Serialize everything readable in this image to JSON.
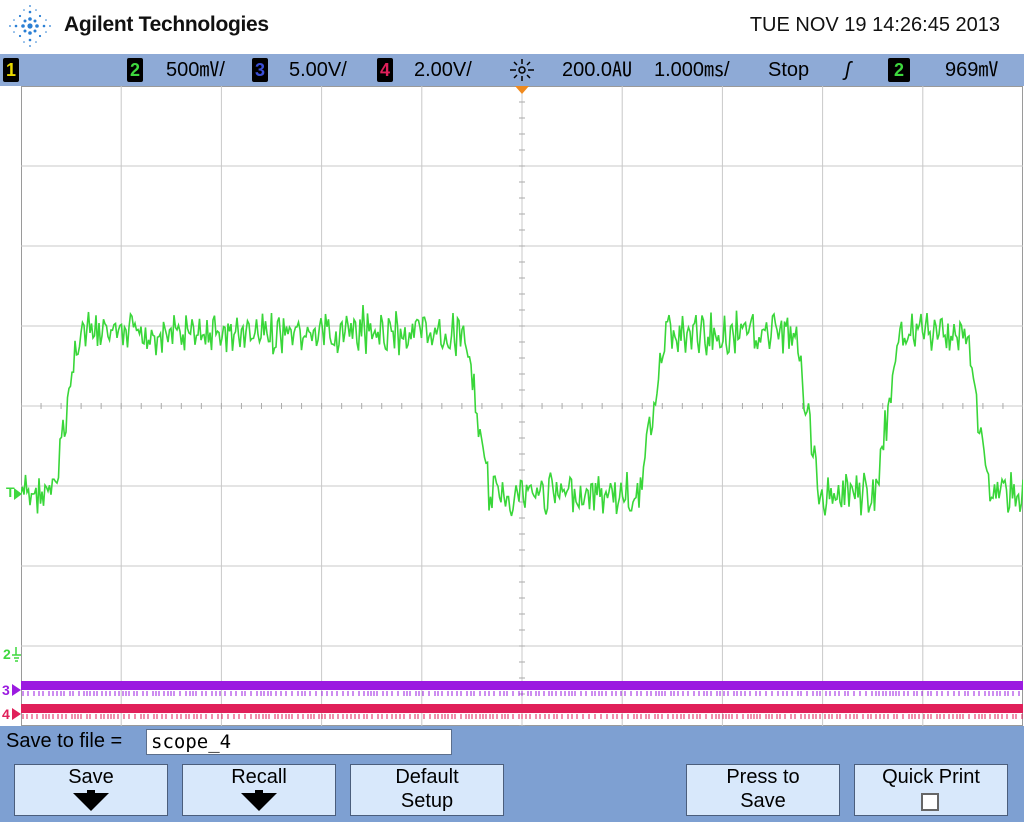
{
  "header": {
    "brand": "Agilent Technologies",
    "datetime": "TUE NOV 19 14:26:45 2013"
  },
  "status": {
    "ch1": "1",
    "ch2": "2",
    "ch2_scale": "500㎷/",
    "ch3": "3",
    "ch3_scale": "5.00V/",
    "ch4": "4",
    "ch4_scale": "2.00V/",
    "delay": "200.0㍳",
    "timebase": "1.000㎳/",
    "run_state": "Stop",
    "trigger_edge": "ʃ",
    "trigger_source": "2",
    "trigger_level": "969㎷",
    "colors": {
      "ch1": "#e8d800",
      "ch2": "#3ed83e",
      "ch3": "#3a4fd6",
      "ch4": "#e0205a"
    }
  },
  "markers": {
    "trigger_marker": "T",
    "ch2_ground": "2",
    "ch3_ground": "3",
    "ch4_ground": "4"
  },
  "softkeys": {
    "save_to_file_label": "Save to file =",
    "save_to_file_value": "scope_4",
    "save": "Save",
    "recall": "Recall",
    "default_line1": "Default",
    "default_line2": "Setup",
    "press_line1": "Press to",
    "press_line2": "Save",
    "quick_print": "Quick Print"
  },
  "waveform": {
    "channel": "2",
    "color": "#39d639",
    "high_level_divisions": 1.0,
    "low_level_divisions": -1.0,
    "transitions_divisions": [
      0.45,
      4.55,
      6.3,
      7.85,
      8.65,
      9.55
    ],
    "digital_ch3_color": "#9b1be0",
    "digital_ch4_color": "#e0205a"
  }
}
